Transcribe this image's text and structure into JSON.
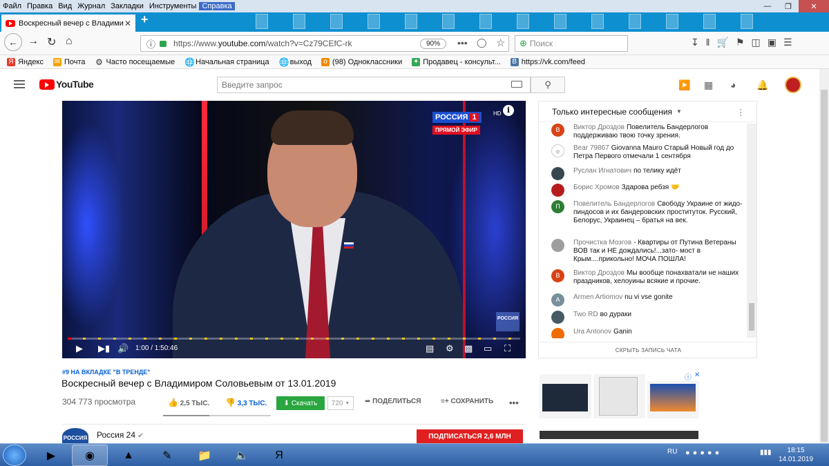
{
  "menu": [
    "Файл",
    "Правка",
    "Вид",
    "Журнал",
    "Закладки",
    "Инструменты",
    "Справка"
  ],
  "tab": {
    "title": "Воскресный вечер с Владими"
  },
  "nav": {
    "url_prefix": "https://www.",
    "url_host": "youtube.com",
    "url_path": "/watch?v=Cz79CEfC-rk",
    "zoom": "90%",
    "search_placeholder": "Поиск"
  },
  "bookmarks": [
    {
      "label": "Яндекс",
      "icon": "yandex-icon",
      "color": "#e8392b"
    },
    {
      "label": "Почта",
      "icon": "mail-icon",
      "color": "#f2a400"
    },
    {
      "label": "Часто посещаемые",
      "icon": "gear-icon",
      "color": "#555555"
    },
    {
      "label": "Начальная страница",
      "icon": "globe-icon",
      "color": "#555555"
    },
    {
      "label": "выход",
      "icon": "globe-icon",
      "color": "#555555"
    },
    {
      "label": "(98) Одноклассники",
      "icon": "ok-icon",
      "color": "#f28a00"
    },
    {
      "label": "Продавец - консульт...",
      "icon": "puzzle-icon",
      "color": "#34a853"
    },
    {
      "label": "https://vk.com/feed",
      "icon": "vk-icon",
      "color": "#4a76a8"
    }
  ],
  "yt": {
    "logo": "YouTube",
    "search_placeholder": "Введите запрос"
  },
  "player": {
    "channel_logo": "РОССИЯ",
    "channel_num": "1",
    "hd": "HD",
    "live": "ПРЯМОЙ ЭФИР",
    "watermark": "РОССИЯ",
    "time": "1:00 / 1:50:46",
    "progress": 0.009
  },
  "chat": {
    "header": "Только интересные сообщения",
    "hide": "СКРЫТЬ ЗАПИСЬ ЧАТА",
    "messages": [
      {
        "author": "Виктор Дроздов",
        "text": "Повелитель Бандерлогов поддерживаю твою точку зрения.",
        "initial": "В",
        "color": "#d84315"
      },
      {
        "author": "Bear 79867",
        "text": "Giovanna Mauro Старый Новый год до Петра Первого отмечали 1 сентября",
        "initial": "",
        "color": "#9e9e9e"
      },
      {
        "author": "Руслан Игнатович",
        "text": "по телику идёт",
        "initial": "",
        "color": "#37474f"
      },
      {
        "author": "Борис Хромов",
        "text": "Здарова ребзя 🤝",
        "initial": "",
        "color": "#b71c1c"
      },
      {
        "author": "Повелитель Бандерлогов",
        "text": "Свободу Украине от жидо-пиндосов и их бандеровских проституток. Русский, Белорус, Украинец – братья на век.",
        "initial": "П",
        "color": "#2e7d32"
      },
      {
        "author": "Прочистка Мозгов",
        "text": "- Квартиры от Путина Ветераны ВОВ так и НЕ дождались!...зато- мост в Крым....прикольно! МОЧА ПОШЛА!",
        "initial": "",
        "color": "#9e9e9e"
      },
      {
        "author": "Виктор Дроздов",
        "text": "Мы вообще понахватали не наших праздников, хелоуины всякие и прочие.",
        "initial": "В",
        "color": "#d84315"
      },
      {
        "author": "Armen Artiomov",
        "text": "nu vi vse gonite",
        "initial": "A",
        "color": "#78909c"
      },
      {
        "author": "Two RD",
        "text": "во дураки",
        "initial": "",
        "color": "#455a64"
      },
      {
        "author": "Ura Antonov",
        "text": "Ganin",
        "initial": "",
        "color": "#ef6c00"
      }
    ]
  },
  "video": {
    "trend": "#9 НА ВКЛАДКЕ \"В ТРЕНДЕ\"",
    "title": "Воскресный вечер с Владимиром Соловьевым от 13.01.2019",
    "views": "304 773 просмотра",
    "likes": "2,5 ТЫС.",
    "dislikes": "3,3 ТЫС.",
    "like_ratio": 0.43,
    "download": "Скачать",
    "quality": "720",
    "share": "ПОДЕЛИТЬСЯ",
    "save": "СОХРАНИТЬ",
    "channel": "Россия 24",
    "channel_avatar": "РОССИЯ",
    "subscribe": "ПОДПИСАТЬСЯ 2,6 МЛН"
  },
  "taskbar": {
    "lang": "RU",
    "time": "18:15",
    "date": "14.01.2019"
  }
}
